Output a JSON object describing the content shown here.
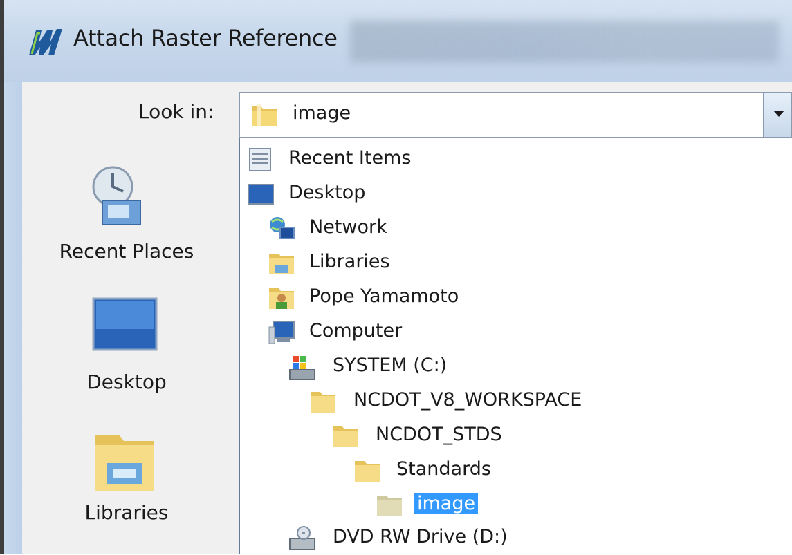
{
  "window": {
    "title": "Attach Raster Reference"
  },
  "look_in": {
    "label": "Look in:",
    "value": "image"
  },
  "places": [
    {
      "label": "Recent Places",
      "icon": "recent-places-icon"
    },
    {
      "label": "Desktop",
      "icon": "desktop-icon"
    },
    {
      "label": "Libraries",
      "icon": "libraries-icon"
    }
  ],
  "dropdown_items": [
    {
      "label": "Recent Items",
      "icon": "recent-items-icon"
    },
    {
      "label": "Desktop",
      "icon": "desktop-icon"
    },
    {
      "label": "Network",
      "icon": "network-icon"
    },
    {
      "label": "Libraries",
      "icon": "libraries-icon"
    },
    {
      "label": "Pope Yamamoto",
      "icon": "user-folder-icon"
    },
    {
      "label": "Computer",
      "icon": "computer-icon"
    },
    {
      "label": "SYSTEM (C:)",
      "icon": "drive-c-icon"
    },
    {
      "label": "NCDOT_V8_WORKSPACE",
      "icon": "folder-icon"
    },
    {
      "label": "NCDOT_STDS",
      "icon": "folder-icon"
    },
    {
      "label": "Standards",
      "icon": "folder-icon"
    },
    {
      "label": "image",
      "icon": "folder-icon",
      "selected": true
    },
    {
      "label": "DVD RW Drive (D:)",
      "icon": "dvd-drive-icon"
    }
  ],
  "colors": {
    "selection": "#3399ff",
    "titlebar": "#c7d8ec"
  }
}
